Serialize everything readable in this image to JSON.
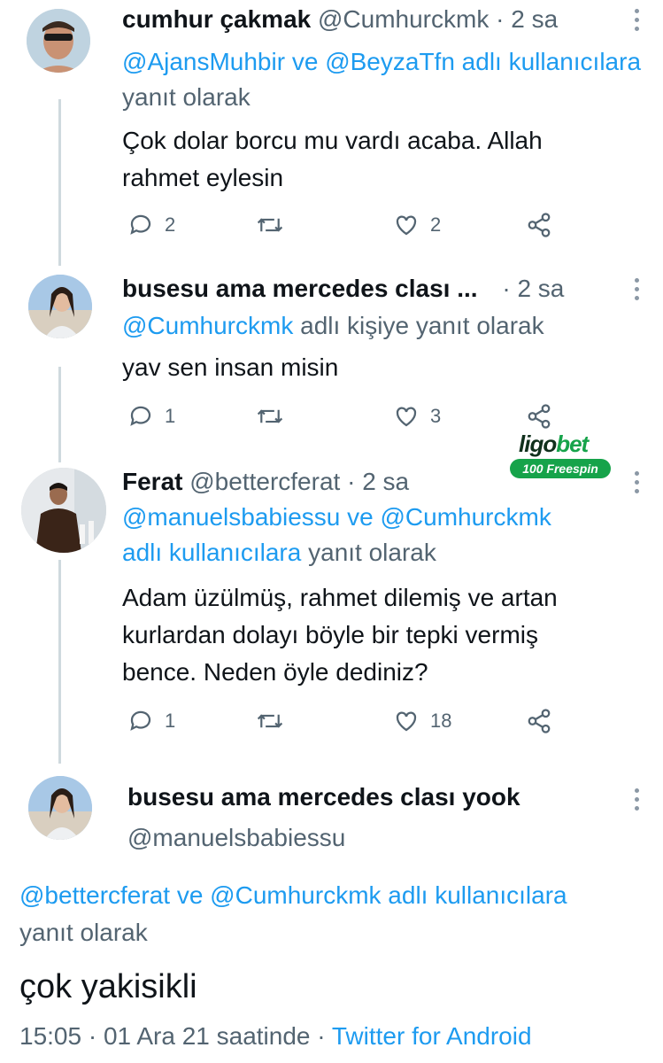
{
  "tweets": [
    {
      "name": "cumhur çakmak",
      "handle": "@Cumhurckmk",
      "time": "2 sa",
      "reply": {
        "mention1": "@AjansMuhbir",
        "joiner1": " ve ",
        "mention2": "@BeyzaTfn",
        "tail_link": " adlı kullanıcılara",
        "tail": " yanıt olarak"
      },
      "text_lines": [
        "Çok dolar borcu mu vardı acaba. Allah",
        "rahmet eylesin"
      ],
      "replies": "2",
      "retweets": "",
      "likes": "2"
    },
    {
      "name": "busesu ama mercedes clası ...",
      "handle": "",
      "time": "2 sa",
      "reply": {
        "mention1": "@Cumhurckmk",
        "tail": " adlı kişiye yanıt olarak"
      },
      "text_lines": [
        "yav sen insan misin"
      ],
      "replies": "1",
      "retweets": "",
      "likes": "3"
    },
    {
      "name": "Ferat",
      "handle": "@bettercferat",
      "time": "2 sa",
      "reply": {
        "mention1": "@manuelsbabiessu",
        "joiner1": " ve ",
        "mention2": "@Cumhurckmk",
        "tail_link": "adlı kullanıcılara",
        "tail": " yanıt olarak"
      },
      "text_lines": [
        "Adam üzülmüş, rahmet dilemiş ve artan",
        "kurlardan dolayı böyle bir tepki vermiş",
        "bence. Neden öyle dediniz?"
      ],
      "replies": "1",
      "retweets": "",
      "likes": "18"
    }
  ],
  "ad": {
    "brand_a": "ligo",
    "brand_b": "bet",
    "pill": "100 Freespin"
  },
  "main": {
    "name": "busesu ama mercedes clası yook",
    "handle": "@manuelsbabiessu",
    "reply_line1": "@bettercferat ve @Cumhurckmk adlı kullanıcılara",
    "reply_line2": "yanıt olarak",
    "text": "çok yakisikli",
    "time": "15:05",
    "date": "01 Ara 21 saatinde",
    "source": "Twitter for Android"
  },
  "separator": " · ",
  "colors": {
    "link": "#1d9bf0",
    "muted": "#536471",
    "brand_green": "#16a34a"
  },
  "icons": [
    "reply-icon",
    "retweet-icon",
    "like-icon",
    "share-icon",
    "more-icon"
  ]
}
